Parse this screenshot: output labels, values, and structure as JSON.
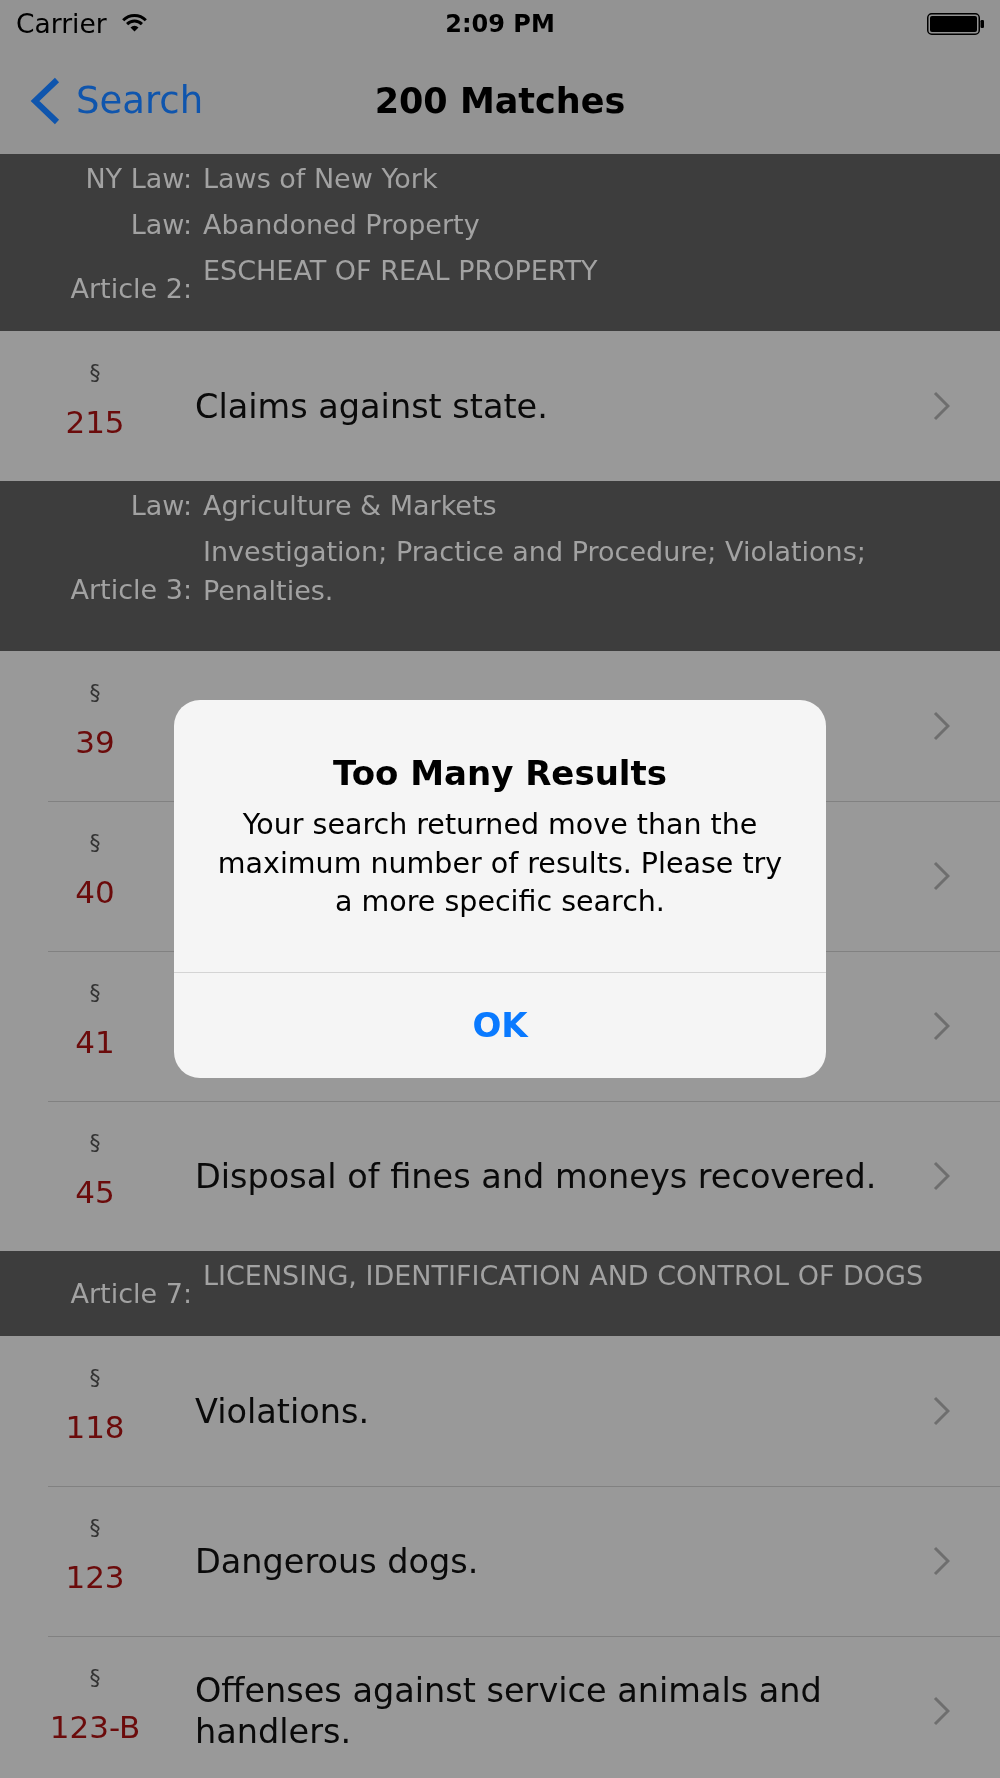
{
  "status_bar": {
    "carrier": "Carrier",
    "time": "2:09 PM"
  },
  "nav_bar": {
    "back_label": "Search",
    "title": "200 Matches"
  },
  "sections": [
    {
      "header": [
        {
          "kind": "field",
          "label": "NY Law:",
          "value": "Laws of New York"
        },
        {
          "kind": "field",
          "label": "Law:",
          "value": "Abandoned Property"
        },
        {
          "kind": "article",
          "label": "Article 2:",
          "value": "ESCHEAT OF REAL PROPERTY"
        }
      ],
      "rows": [
        {
          "symbol": "§",
          "number": "215",
          "title": "Claims against state."
        }
      ]
    },
    {
      "header": [
        {
          "kind": "field",
          "label": "Law:",
          "value": "Agriculture & Markets"
        },
        {
          "kind": "article",
          "label": "Article 3:",
          "value": "Investigation; Practice and Procedure; Violations; Penalties."
        }
      ],
      "rows": [
        {
          "symbol": "§",
          "number": "39"
        },
        {
          "symbol": "§",
          "number": "40"
        },
        {
          "symbol": "§",
          "number": "41"
        },
        {
          "symbol": "§",
          "number": "45",
          "title": "Disposal of fines and moneys recovered."
        }
      ]
    },
    {
      "header": [
        {
          "kind": "article",
          "label": "Article 7:",
          "value": "LICENSING, IDENTIFICATION AND CONTROL OF DOGS"
        }
      ],
      "rows": [
        {
          "symbol": "§",
          "number": "118",
          "title": "Violations."
        },
        {
          "symbol": "§",
          "number": "123",
          "title": "Dangerous dogs."
        },
        {
          "symbol": "§",
          "number": "123-B",
          "title": "Offenses against service animals and handlers."
        }
      ]
    }
  ],
  "alert": {
    "title": "Too Many Results",
    "message": "Your search returned move than the maximum number of results. Please try a more specific search.",
    "buttons": [
      "OK"
    ]
  }
}
